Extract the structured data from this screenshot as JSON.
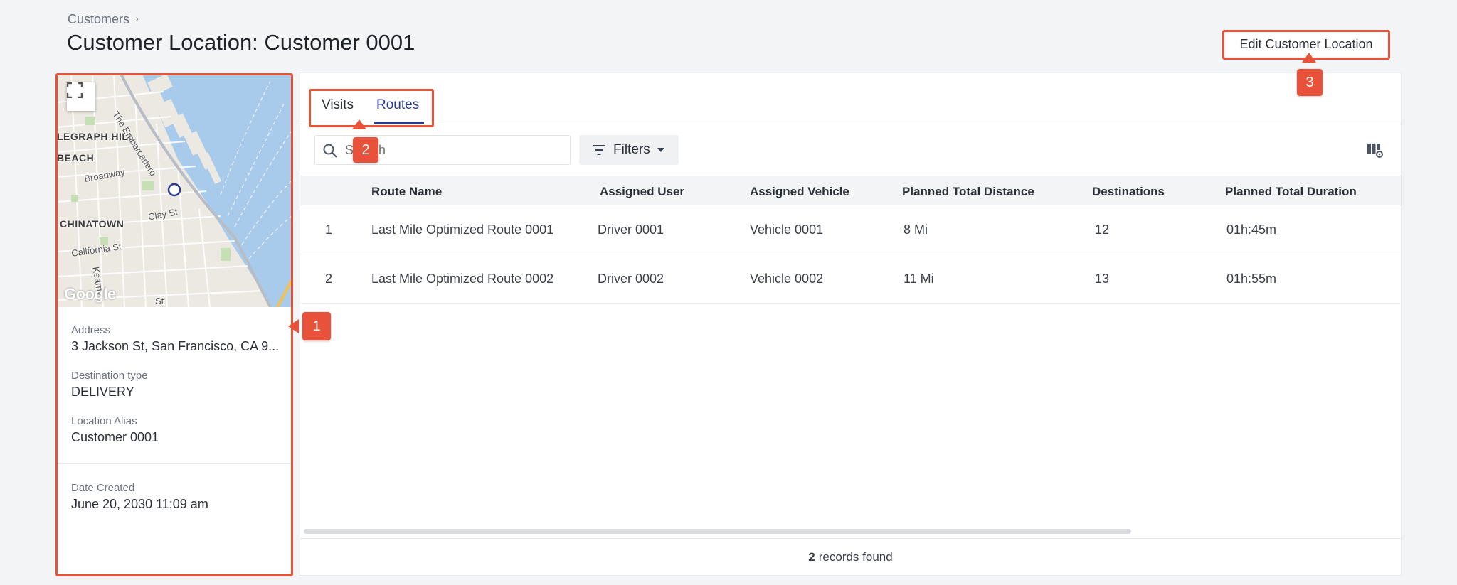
{
  "breadcrumb": {
    "items": [
      "Customers"
    ],
    "separator": "›"
  },
  "page": {
    "title": "Customer Location: Customer 0001"
  },
  "actions": {
    "edit_label": "Edit Customer Location"
  },
  "annotations": [
    "1",
    "2",
    "3"
  ],
  "map": {
    "labels": [
      "LEGRAPH HILL",
      "BEACH",
      "CHINATOWN"
    ],
    "streets": [
      "The Embarcadero",
      "Broadway",
      "Clay St",
      "California St",
      "Kearny",
      "St"
    ],
    "provider": "Google"
  },
  "location": {
    "fields": [
      {
        "label": "Address",
        "value": "3 Jackson St, San Francisco, CA 9..."
      },
      {
        "label": "Destination type",
        "value": "DELIVERY"
      },
      {
        "label": "Location Alias",
        "value": "Customer 0001"
      }
    ],
    "date_created": {
      "label": "Date Created",
      "value": "June 20, 2030 11:09 am"
    }
  },
  "tabs": [
    {
      "label": "Visits",
      "active": false
    },
    {
      "label": "Routes",
      "active": true
    }
  ],
  "toolbar": {
    "search_placeholder": "Search",
    "filters_label": "Filters"
  },
  "table": {
    "columns": [
      "Route Name",
      "Assigned User",
      "Assigned Vehicle",
      "Planned Total Distance",
      "Destinations",
      "Planned Total Duration"
    ],
    "rows": [
      {
        "index": "1",
        "route_name": "Last Mile Optimized Route 0001",
        "assigned_user": "Driver 0001",
        "assigned_vehicle": "Vehicle 0001",
        "distance": "8 Mi",
        "destinations": "12",
        "duration": "01h:45m"
      },
      {
        "index": "2",
        "route_name": "Last Mile Optimized Route 0002",
        "assigned_user": "Driver 0002",
        "assigned_vehicle": "Vehicle 0002",
        "distance": "11 Mi",
        "destinations": "13",
        "duration": "01h:55m"
      }
    ]
  },
  "footer": {
    "count": "2",
    "suffix": "records found"
  },
  "colors": {
    "accent": "#2b3a8f",
    "callout": "#e8513a",
    "water": "#a8cbec",
    "background": "#f3f4f6"
  }
}
